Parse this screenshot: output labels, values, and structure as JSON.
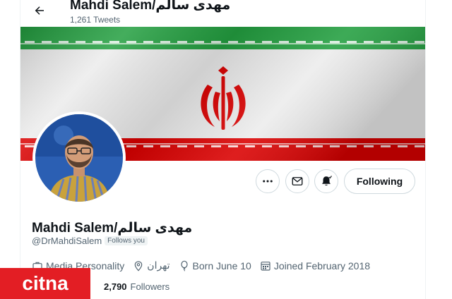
{
  "header": {
    "display_name": "Mahdi Salem/مهدی سالم",
    "tweet_count": "1,261 Tweets"
  },
  "actions": {
    "following_label": "Following"
  },
  "profile": {
    "display_name": "Mahdi Salem/مهدی سالم",
    "handle": "@DrMahdiSalem",
    "follows_you": "Follows you",
    "category": "Media Personality",
    "location": "تهران",
    "birthday": "Born June 10",
    "joined": "Joined February 2018",
    "followers_count": "2,790",
    "followers_label": "Followers"
  },
  "watermark": {
    "text": "citna",
    "color": "#e31e24"
  },
  "icons": [
    "back-arrow-icon",
    "more-icon",
    "mail-icon",
    "bell-icon",
    "briefcase-icon",
    "location-icon",
    "balloon-icon",
    "calendar-icon"
  ],
  "colors": {
    "flag_green": "#239f40",
    "flag_red": "#da0000",
    "text_primary": "#0f1419",
    "text_secondary": "#536471"
  }
}
